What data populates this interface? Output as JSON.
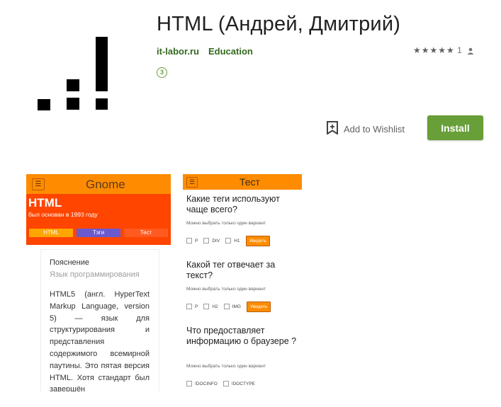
{
  "app": {
    "title": "HTML (Андрей, Дмитрий)",
    "developer": "it-labor.ru",
    "category": "Education",
    "age_rating": "3",
    "rating_stars": 5,
    "rating_count": "1",
    "wishlist_label": "Add to Wishlist",
    "install_label": "Install"
  },
  "colors": {
    "accent_green": "#689f38",
    "link_green": "#33691e",
    "screenshot_orange": "#ff8c00",
    "screenshot_red": "#ff4500"
  },
  "icons": {
    "app": "signal-bars-icon",
    "wishlist": "bookmark-plus-icon",
    "person": "person-icon",
    "star": "star-icon",
    "menu": "hamburger-icon"
  },
  "screenshot1": {
    "header_title": "Gnome",
    "heading": "HTML",
    "subheading": "был основан в 1993 году",
    "tabs": [
      "HTML",
      "Тэги",
      "Тест"
    ],
    "panel_title": "Пояснение",
    "panel_subtitle": "Язык программирования",
    "panel_body": "HTML5 (англ. HyperText Markup Language, version 5) — язык для структурирования и представления содержимого всемирной паутины. Это пятая версия HTML. Хотя стандарт был завершён"
  },
  "screenshot2": {
    "header_title": "Тест",
    "questions": [
      {
        "text": "Какие теги используют чаще всего?",
        "hint": "Можно выбрать только один вариант",
        "options": [
          "P",
          "DIV",
          "H1"
        ],
        "button": "Увидеть"
      },
      {
        "text": "Какой тег отвечает за текст?",
        "hint": "Можно выбрать только один вариант",
        "options": [
          "P",
          "H2",
          "IMG"
        ],
        "button": "Увидеть"
      },
      {
        "text": "Что предоставляет информацию о браузере ?",
        "hint": "Можно выбрать только один вариант",
        "options": [
          "!DOCINFO",
          "!DOCTYPE"
        ],
        "button": ""
      }
    ]
  }
}
